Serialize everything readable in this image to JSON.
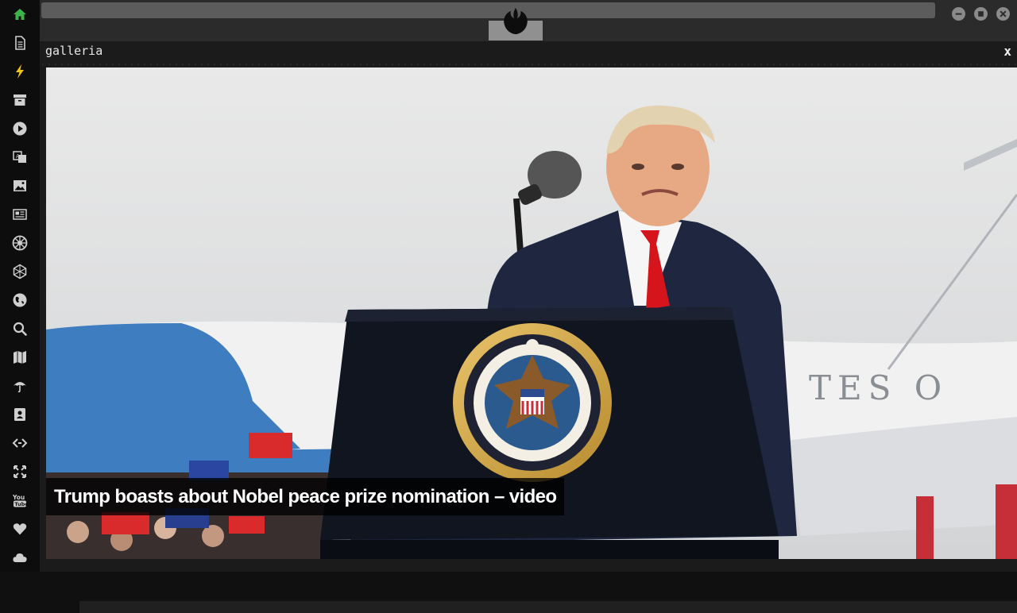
{
  "window": {
    "title": "galleria",
    "close_label": "x"
  },
  "gallery": {
    "caption": "Trump boasts about Nobel peace prize nomination – video"
  },
  "sidebar": {
    "items": [
      "home-icon",
      "document-icon",
      "bolt-icon",
      "archive-icon",
      "play-icon",
      "translate-icon",
      "image-icon",
      "newspaper-icon",
      "empire-icon",
      "hexagon-icon",
      "globe-icon",
      "search-icon",
      "map-icon",
      "umbrella-icon",
      "contact-card-icon",
      "code-icon",
      "fullscreen-icon",
      "youtube-icon",
      "heart-icon",
      "cloud-icon"
    ]
  },
  "colors": {
    "accent": "#3cb44a",
    "photo_text": "TES O"
  }
}
